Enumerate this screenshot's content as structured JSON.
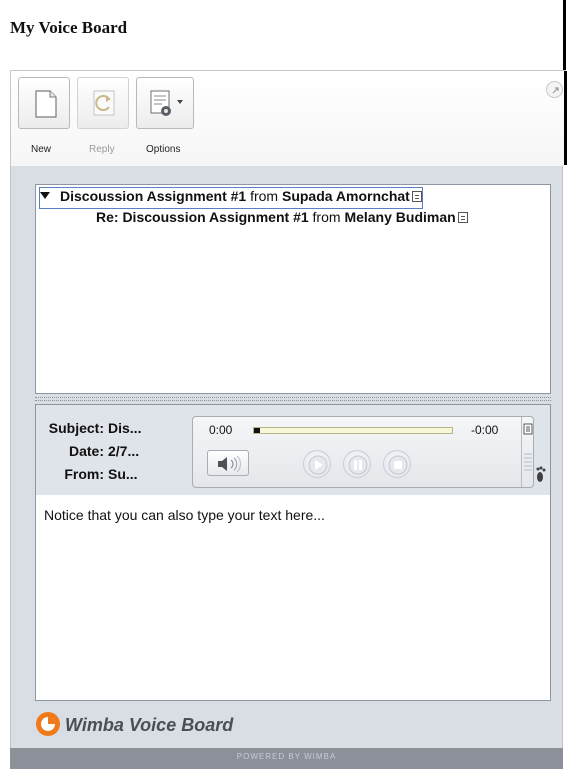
{
  "app": {
    "title": "My Voice Board"
  },
  "toolbar": {
    "buttons": [
      {
        "label": "New",
        "icon": "new-document-icon",
        "enabled": true
      },
      {
        "label": "Reply",
        "icon": "reply-icon",
        "enabled": false
      },
      {
        "label": "Options",
        "icon": "options-gear-icon",
        "enabled": true
      }
    ]
  },
  "threads": [
    {
      "title": "Discoussion Assignment #1",
      "from_word": "from",
      "author": "Supada Amornchat",
      "expanded": true,
      "selected": true
    },
    {
      "title": "Re: Discoussion Assignment #1",
      "from_word": "from",
      "author": "Melany Budiman",
      "selected": false
    }
  ],
  "message": {
    "subject_label": "Subject:",
    "subject": "Dis...",
    "date_label": "Date:",
    "date": "2/7...",
    "from_label": "From:",
    "from": "Su...",
    "body": "Notice that you can also type your text here..."
  },
  "player": {
    "elapsed": "0:00",
    "remaining": "-0:00",
    "progress": 0
  },
  "brand": {
    "name": "Wimba Voice Board"
  },
  "footer": {
    "text": "POWERED BY WIMBA"
  },
  "colors": {
    "panel_bg": "#d9dde4",
    "footer_bg": "#8b9099",
    "brand_orange": "#f07a1a",
    "selection_outline": "#5a7fc2"
  }
}
